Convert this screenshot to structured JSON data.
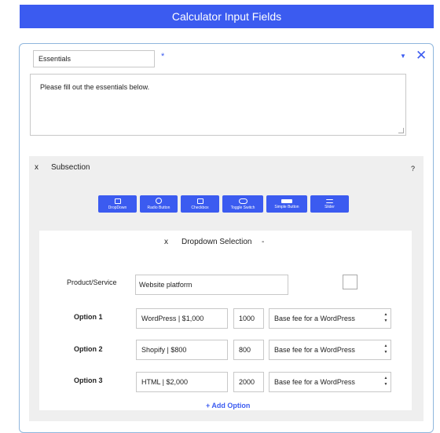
{
  "header": {
    "title": "Calculator Input Fields"
  },
  "section": {
    "title_value": "Essentials",
    "required_mark": "*",
    "description": "Please fill out the essentials below."
  },
  "subsection": {
    "close": "x",
    "title": "Subsection",
    "help": "?",
    "tools": [
      {
        "label": "DropDown",
        "icon": "list-icon"
      },
      {
        "label": "Radio Button",
        "icon": "radio-icon"
      },
      {
        "label": "Checkbox",
        "icon": "checkbox-icon"
      },
      {
        "label": "Toggle Switch",
        "icon": "toggle-icon"
      },
      {
        "label": "Simple Button",
        "icon": "button-icon"
      },
      {
        "label": "Slider",
        "icon": "slider-icon"
      }
    ]
  },
  "dropdown": {
    "close": "x",
    "title": "Dropdown Selection",
    "dash": "-",
    "product_label": "Product/Service",
    "product_value": "Website platform",
    "options": [
      {
        "label": "Option 1",
        "name": "WordPress | $1,000",
        "price": "1000",
        "note": "Base fee for a WordPress"
      },
      {
        "label": "Option 2",
        "name": "Shopify | $800",
        "price": "800",
        "note": "Base fee for a WordPress"
      },
      {
        "label": "Option 3",
        "name": "HTML | $2,000",
        "price": "2000",
        "note": "Base fee for a WordPress"
      }
    ],
    "add_option": "+ Add Option"
  }
}
